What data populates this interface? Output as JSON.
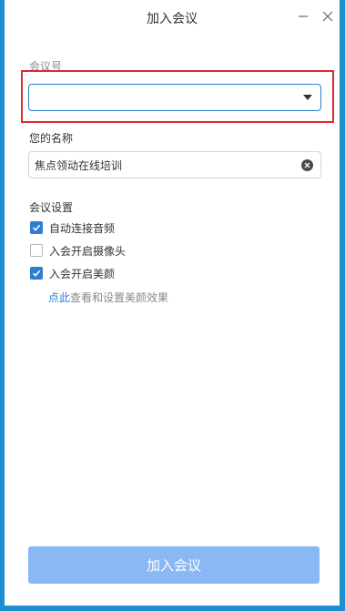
{
  "window": {
    "title": "加入会议",
    "controls": [
      "minimize-icon",
      "close-icon"
    ]
  },
  "meeting_id": {
    "label": "会议号",
    "value": ""
  },
  "name": {
    "label": "您的名称",
    "value": "焦点领动在线培训"
  },
  "settings": {
    "label": "会议设置",
    "options": [
      {
        "label": "自动连接音频",
        "checked": true
      },
      {
        "label": "入会开启摄像头",
        "checked": false
      },
      {
        "label": "入会开启美颜",
        "checked": true
      }
    ],
    "hint_link": "点此",
    "hint_rest": "查看和设置美颜效果"
  },
  "join_button": {
    "label": "加入会议"
  },
  "colors": {
    "accent": "#2d7dd2",
    "highlight": "#e0292e",
    "join_disabled": "#8ab8f5",
    "frame": "#1b8fd0"
  }
}
